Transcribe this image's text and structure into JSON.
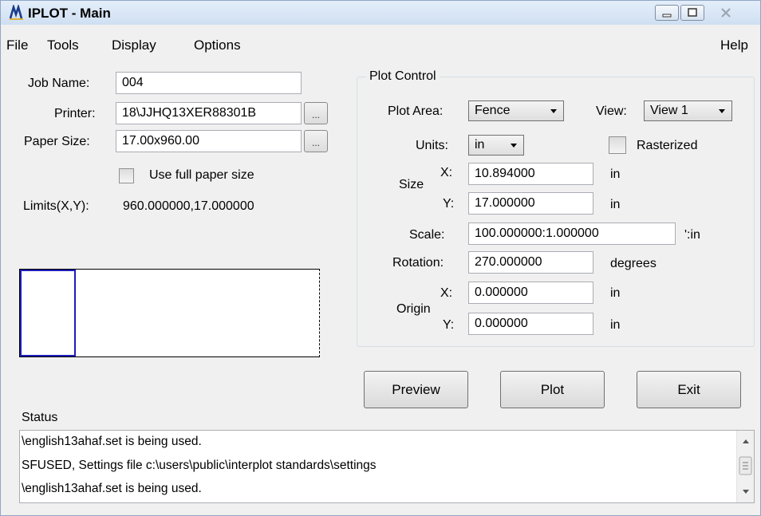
{
  "window": {
    "title": "IPLOT - Main"
  },
  "menu": {
    "file": "File",
    "tools": "Tools",
    "display": "Display",
    "options": "Options",
    "help": "Help"
  },
  "job": {
    "job_name_label": "Job Name:",
    "job_name_value": "004",
    "printer_label": "Printer:",
    "printer_value": "18\\JJHQ13XER88301B",
    "paper_size_label": "Paper Size:",
    "paper_size_value": "17.00x960.00",
    "browse_label": "...",
    "full_paper_label": "Use full paper size",
    "full_paper_checked": false,
    "limits_label": "Limits(X,Y):",
    "limits_value": "960.000000,17.000000"
  },
  "plot_control": {
    "title": "Plot Control",
    "plot_area_label": "Plot Area:",
    "plot_area_value": "Fence",
    "view_label": "View:",
    "view_value": "View 1",
    "units_label": "Units:",
    "units_value": "in",
    "rasterized_label": "Rasterized",
    "rasterized_checked": false,
    "size_label": "Size",
    "x_label": "X:",
    "y_label": "Y:",
    "size_x": "10.894000",
    "size_y": "17.000000",
    "size_unit": "in",
    "scale_label": "Scale:",
    "scale_value": "100.000000:1.000000",
    "scale_unit": "':in",
    "rotation_label": "Rotation:",
    "rotation_value": "270.000000",
    "rotation_unit": "degrees",
    "origin_label": "Origin",
    "origin_x": "0.000000",
    "origin_y": "0.000000",
    "origin_unit": "in"
  },
  "buttons": {
    "preview": "Preview",
    "plot": "Plot",
    "exit": "Exit"
  },
  "status": {
    "label": "Status",
    "lines": [
      "\\english13ahaf.set is being used.",
      "SFUSED, Settings file c:\\users\\public\\interplot standards\\settings",
      "\\english13ahaf.set is being used."
    ]
  },
  "icons": {
    "app": "iplot-app-icon",
    "minimize": "minimize-icon",
    "maximize": "maximize-icon",
    "close": "close-icon",
    "dropdown": "chevron-down-icon",
    "scroll_up": "scroll-up-arrow-icon",
    "scroll_down": "scroll-down-arrow-icon",
    "scroll_thumb": "scroll-grip-icon"
  },
  "colors": {
    "preview_outline": "#1c1cb8",
    "window_bg": "#f0f0f0"
  }
}
